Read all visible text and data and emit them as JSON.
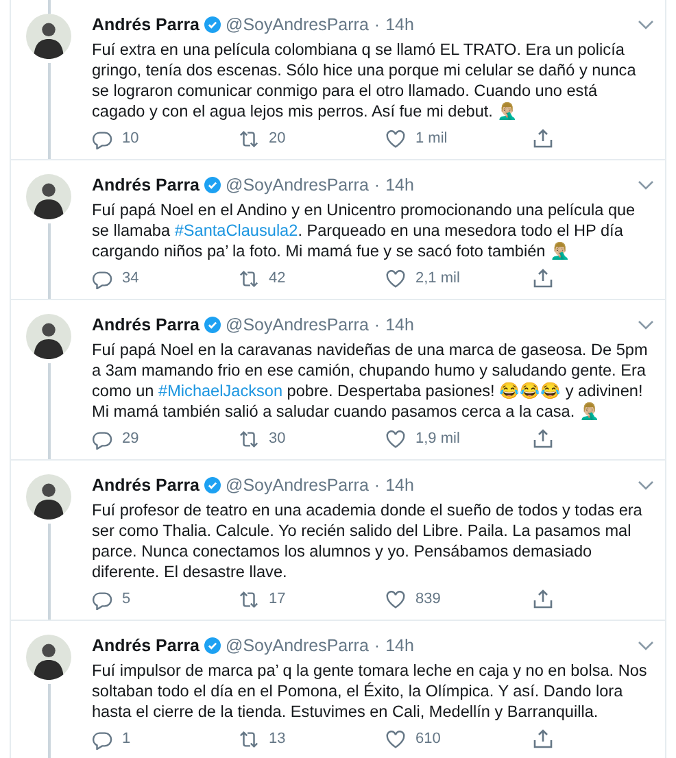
{
  "tweets": [
    {
      "name": "Andrés Parra",
      "verified": true,
      "handle": "@SoyAndresParra",
      "separator": "·",
      "time": "14h",
      "thread_above": true,
      "text": [
        {
          "kind": "text",
          "text": "Fuí extra en una película colombiana q se llamó EL TRATO. Era un policía gringo, tenía dos escenas. Sólo hice una porque mi celular se dañó y nunca se lograron comunicar conmigo para el otro llamado. Cuando uno está cagado y con el agua lejos mis perros. Así fue mi debut. 🤦🏼‍♂️"
        }
      ],
      "replies": "10",
      "retweets": "20",
      "likes": "1 mil"
    },
    {
      "name": "Andrés Parra",
      "verified": true,
      "handle": "@SoyAndresParra",
      "separator": "·",
      "time": "14h",
      "thread_above": false,
      "text": [
        {
          "kind": "text",
          "text": "Fuí papá Noel en el Andino y en Unicentro promocionando una película que se llamaba "
        },
        {
          "kind": "hashtag",
          "text": "#SantaClausula2"
        },
        {
          "kind": "text",
          "text": ". Parqueado en una mesedora todo el HP día cargando niños pa’ la foto. Mi mamá fue y se sacó foto también 🤦🏼‍♂️"
        }
      ],
      "replies": "34",
      "retweets": "42",
      "likes": "2,1 mil"
    },
    {
      "name": "Andrés Parra",
      "verified": true,
      "handle": "@SoyAndresParra",
      "separator": "·",
      "time": "14h",
      "thread_above": false,
      "text": [
        {
          "kind": "text",
          "text": "Fuí papá Noel en la caravanas navideñas de una marca de gaseosa. De 5pm a 3am mamando frio en ese camión, chupando humo y saludando gente. Era como un "
        },
        {
          "kind": "hashtag",
          "text": "#MichaelJackson"
        },
        {
          "kind": "text",
          "text": " pobre. Despertaba pasiones! 😂😂😂 y adivinen! Mi mamá también salió a saludar cuando pasamos cerca a la casa. 🤦🏼‍♂️"
        }
      ],
      "replies": "29",
      "retweets": "30",
      "likes": "1,9 mil"
    },
    {
      "name": "Andrés Parra",
      "verified": true,
      "handle": "@SoyAndresParra",
      "separator": "·",
      "time": "14h",
      "thread_above": false,
      "text": [
        {
          "kind": "text",
          "text": "Fuí profesor de teatro en una academia donde el sueño de todos y todas era ser como Thalia. Calcule. Yo recién salido del Libre. Paila. La pasamos mal parce. Nunca conectamos los alumnos y yo. Pensábamos demasiado diferente. El desastre llave."
        }
      ],
      "replies": "5",
      "retweets": "17",
      "likes": "839"
    },
    {
      "name": "Andrés Parra",
      "verified": true,
      "handle": "@SoyAndresParra",
      "separator": "·",
      "time": "14h",
      "thread_above": false,
      "text": [
        {
          "kind": "text",
          "text": "Fuí impulsor de marca pa’ q la gente tomara leche en caja y no en bolsa. Nos soltaban todo el día en el Pomona, el Éxito, la Olímpica. Y así. Dando lora hasta el cierre de la tienda. Estuvimes en Cali, Medellín y Barranquilla."
        }
      ],
      "replies": "1",
      "retweets": "13",
      "likes": "610"
    }
  ]
}
